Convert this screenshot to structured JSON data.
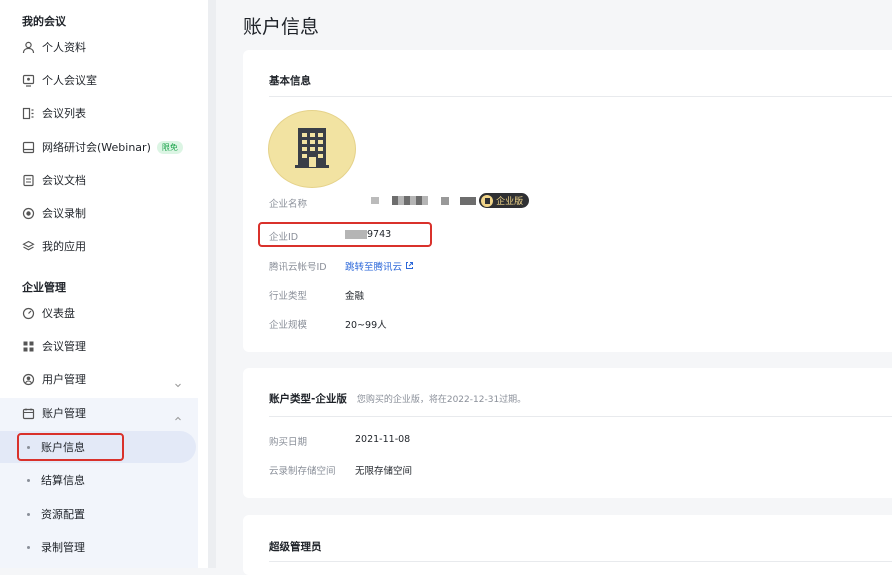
{
  "sidebar": {
    "section_my_meetings": "我的会议",
    "my_items": [
      {
        "label": "个人资料",
        "icon": "user-icon"
      },
      {
        "label": "个人会议室",
        "icon": "meeting-room-icon"
      },
      {
        "label": "会议列表",
        "icon": "list-icon"
      },
      {
        "label": "网络研讨会(Webinar)",
        "icon": "webinar-icon",
        "badge": "限免"
      },
      {
        "label": "会议文档",
        "icon": "document-icon"
      },
      {
        "label": "会议录制",
        "icon": "record-icon"
      },
      {
        "label": "我的应用",
        "icon": "apps-icon"
      }
    ],
    "section_enterprise": "企业管理",
    "enterprise_items": [
      {
        "label": "仪表盘",
        "icon": "dashboard-icon"
      },
      {
        "label": "会议管理",
        "icon": "grid-icon"
      },
      {
        "label": "用户管理",
        "icon": "users-icon"
      },
      {
        "label": "账户管理",
        "icon": "account-icon"
      }
    ],
    "account_sub_items": [
      {
        "label": "账户信息",
        "active": true
      },
      {
        "label": "结算信息",
        "active": false
      },
      {
        "label": "资源配置",
        "active": false
      },
      {
        "label": "录制管理",
        "active": false
      }
    ]
  },
  "main": {
    "page_title": "账户信息",
    "basic_info": {
      "title": "基本信息",
      "rows": [
        {
          "label": "企业名称",
          "value": "",
          "badge": "企业版"
        },
        {
          "label": "企业ID",
          "value": "9743"
        },
        {
          "label": "腾讯云帐号ID",
          "value": "跳转至腾讯云"
        },
        {
          "label": "行业类型",
          "value": "金融"
        },
        {
          "label": "企业规模",
          "value": "20~99人"
        }
      ]
    },
    "account_type": {
      "title": "账户类型-企业版",
      "subtitle": "您购买的企业版，将在2022-12-31过期。",
      "rows": [
        {
          "label": "购买日期",
          "value": "2021-11-08"
        },
        {
          "label": "云录制存储空间",
          "value": "无限存储空间"
        }
      ]
    },
    "super_admin": {
      "title": "超级管理员"
    }
  },
  "colors": {
    "accent": "#2b67d9",
    "highlight": "#d9312b",
    "badge_green": "#1aa34a"
  }
}
